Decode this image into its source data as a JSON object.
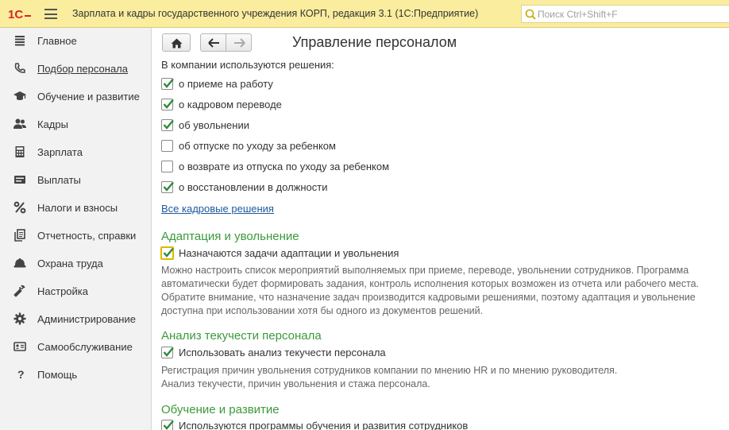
{
  "app": {
    "title": "Зарплата и кадры государственного учреждения КОРП, редакция 3.1  (1С:Предприятие)",
    "logo_text": "1С",
    "search_placeholder": "Поиск Ctrl+Shift+F"
  },
  "sidebar": {
    "items": [
      {
        "label": "Главное",
        "icon": "menu-lines-icon"
      },
      {
        "label": "Подбор персонала",
        "icon": "phone-icon",
        "active": true
      },
      {
        "label": "Обучение и развитие",
        "icon": "graduation-cap-icon"
      },
      {
        "label": "Кадры",
        "icon": "people-icon"
      },
      {
        "label": "Зарплата",
        "icon": "calculator-icon"
      },
      {
        "label": "Выплаты",
        "icon": "wallet-icon"
      },
      {
        "label": "Налоги и взносы",
        "icon": "percent-icon"
      },
      {
        "label": "Отчетность, справки",
        "icon": "documents-icon"
      },
      {
        "label": "Охрана труда",
        "icon": "helmet-icon"
      },
      {
        "label": "Настройка",
        "icon": "wrench-icon"
      },
      {
        "label": "Администрирование",
        "icon": "gear-icon"
      },
      {
        "label": "Самообслуживание",
        "icon": "id-card-icon"
      },
      {
        "label": "Помощь",
        "icon": "question-icon"
      }
    ]
  },
  "main": {
    "title": "Управление персоналом",
    "solutions_heading": "В компании используются решения:",
    "solutions": [
      {
        "label": "о приеме на работу",
        "checked": true
      },
      {
        "label": "о кадровом переводе",
        "checked": true
      },
      {
        "label": "об увольнении",
        "checked": true
      },
      {
        "label": "об отпуске по уходу за ребенком",
        "checked": false
      },
      {
        "label": "о возврате из отпуска по уходу за ребенком",
        "checked": false
      },
      {
        "label": "о восстановлении в должности",
        "checked": true
      }
    ],
    "all_solutions_link": "Все кадровые решения",
    "adaptation": {
      "title": "Адаптация и увольнение",
      "checkbox_label": "Назначаются задачи адаптации и увольнения",
      "checked": true,
      "note_lines": [
        "Можно настроить список мероприятий выполняемых при приеме, переводе, увольнении сотрудников. Программа",
        "автоматически будет формировать задания, контроль исполнения которых возможен из отчета или рабочего места.",
        "Обратите внимание, что назначение задач производится кадровыми решениями, поэтому адаптация и увольнение",
        "доступна при использовании хотя бы одного из документов решений."
      ]
    },
    "turnover": {
      "title": "Анализ текучести персонала",
      "checkbox_label": "Использовать анализ текучести персонала",
      "checked": true,
      "note_lines": [
        "Регистрация причин увольнения сотрудников компании по мнению HR и по мнению руководителя.",
        "Анализ текучести, причин увольнения и стажа персонала."
      ]
    },
    "training": {
      "title": "Обучение и развитие",
      "checkbox_label": "Используются программы обучения и развития сотрудников",
      "checked": true
    }
  },
  "colors": {
    "titlebar": "#fbed9e",
    "section_title": "#3b9a3b",
    "checkmark": "#2e8b3a",
    "link": "#1d5a9e",
    "logo": "#d4262c"
  }
}
